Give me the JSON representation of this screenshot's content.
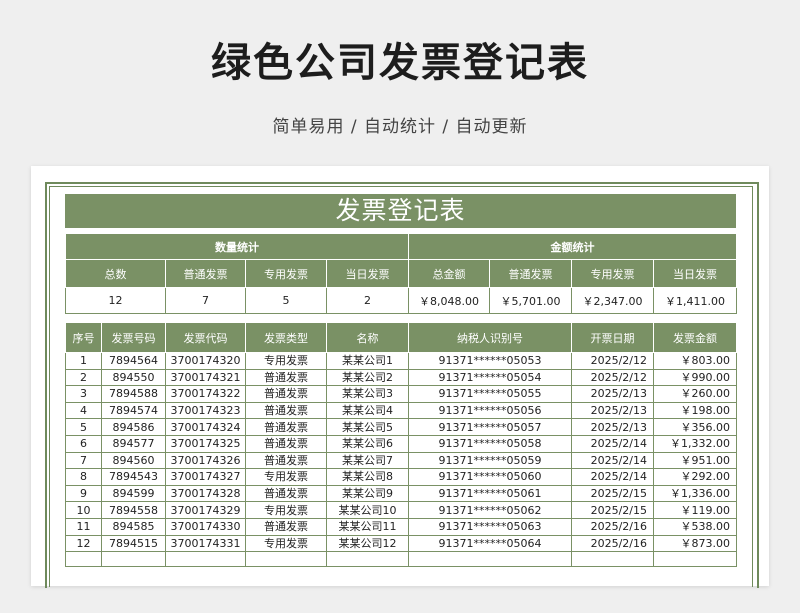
{
  "page": {
    "title": "绿色公司发票登记表",
    "subtitle": "简单易用 / 自动统计 / 自动更新"
  },
  "sheet": {
    "banner": "发票登记表",
    "summary": {
      "group_count": "数量统计",
      "group_amount": "金额统计",
      "headers": [
        "总数",
        "普通发票",
        "专用发票",
        "当日发票",
        "总金额",
        "普通发票",
        "专用发票",
        "当日发票"
      ],
      "values": [
        "12",
        "7",
        "5",
        "2",
        "￥8,048.00",
        "￥5,701.00",
        "￥2,347.00",
        "￥1,411.00"
      ]
    },
    "detail": {
      "headers": [
        "序号",
        "发票号码",
        "发票代码",
        "发票类型",
        "名称",
        "纳税人识别号",
        "开票日期",
        "发票金额"
      ],
      "rows": [
        [
          "1",
          "7894564",
          "3700174320",
          "专用发票",
          "某某公司1",
          "91371******05053",
          "2025/2/12",
          "￥803.00"
        ],
        [
          "2",
          "894550",
          "3700174321",
          "普通发票",
          "某某公司2",
          "91371******05054",
          "2025/2/12",
          "￥990.00"
        ],
        [
          "3",
          "7894588",
          "3700174322",
          "普通发票",
          "某某公司3",
          "91371******05055",
          "2025/2/13",
          "￥260.00"
        ],
        [
          "4",
          "7894574",
          "3700174323",
          "普通发票",
          "某某公司4",
          "91371******05056",
          "2025/2/13",
          "￥198.00"
        ],
        [
          "5",
          "894586",
          "3700174324",
          "普通发票",
          "某某公司5",
          "91371******05057",
          "2025/2/13",
          "￥356.00"
        ],
        [
          "6",
          "894577",
          "3700174325",
          "普通发票",
          "某某公司6",
          "91371******05058",
          "2025/2/14",
          "￥1,332.00"
        ],
        [
          "7",
          "894560",
          "3700174326",
          "普通发票",
          "某某公司7",
          "91371******05059",
          "2025/2/14",
          "￥951.00"
        ],
        [
          "8",
          "7894543",
          "3700174327",
          "专用发票",
          "某某公司8",
          "91371******05060",
          "2025/2/14",
          "￥292.00"
        ],
        [
          "9",
          "894599",
          "3700174328",
          "普通发票",
          "某某公司9",
          "91371******05061",
          "2025/2/15",
          "￥1,336.00"
        ],
        [
          "10",
          "7894558",
          "3700174329",
          "专用发票",
          "某某公司10",
          "91371******05062",
          "2025/2/15",
          "￥119.00"
        ],
        [
          "11",
          "894585",
          "3700174330",
          "普通发票",
          "某某公司11",
          "91371******05063",
          "2025/2/16",
          "￥538.00"
        ],
        [
          "12",
          "7894515",
          "3700174331",
          "专用发票",
          "某某公司12",
          "91371******05064",
          "2025/2/16",
          "￥873.00"
        ]
      ]
    }
  }
}
